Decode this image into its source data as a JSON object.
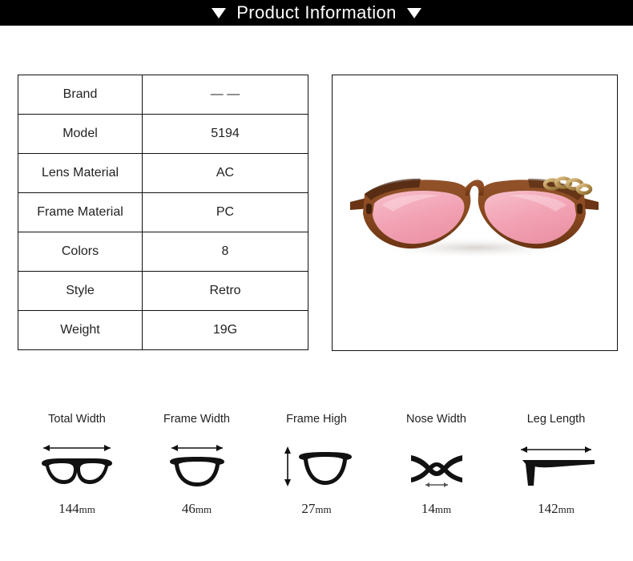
{
  "header": {
    "title": "Product Information",
    "left_marker": "triangle-down",
    "right_marker": "triangle-down",
    "background": "#000000",
    "text_color": "#ffffff"
  },
  "spec_table": {
    "rows": [
      {
        "label": "Brand",
        "value": "— —"
      },
      {
        "label": "Model",
        "value": "5194"
      },
      {
        "label": "Lens Material",
        "value": "AC"
      },
      {
        "label": "Frame Material",
        "value": "PC"
      },
      {
        "label": "Colors",
        "value": "8"
      },
      {
        "label": "Style",
        "value": "Retro"
      },
      {
        "label": "Weight",
        "value": "19G"
      }
    ]
  },
  "product_photo": {
    "alt": "brown cat-eye sunglasses with pink tinted lenses",
    "frame_color": "#8B4A20",
    "frame_dark": "#5B2F13",
    "lens_color": "#F4A8B8",
    "chain_color": "#C8A46A",
    "background": "#ffffff"
  },
  "measurements": [
    {
      "label": "Total Width",
      "number": "144",
      "unit": "mm",
      "icon": "full-eyeglasses-icon",
      "arrow": "horizontal"
    },
    {
      "label": "Frame Width",
      "number": "46",
      "unit": "mm",
      "icon": "single-lens-rim-icon",
      "arrow": "horizontal"
    },
    {
      "label": "Frame High",
      "number": "27",
      "unit": "mm",
      "icon": "lens-height-icon",
      "arrow": "vertical"
    },
    {
      "label": "Nose Width",
      "number": "14",
      "unit": "mm",
      "icon": "nose-bridge-icon",
      "arrow": "horizontal-small"
    },
    {
      "label": "Leg Length",
      "number": "142",
      "unit": "mm",
      "icon": "temple-arm-icon",
      "arrow": "horizontal"
    }
  ]
}
